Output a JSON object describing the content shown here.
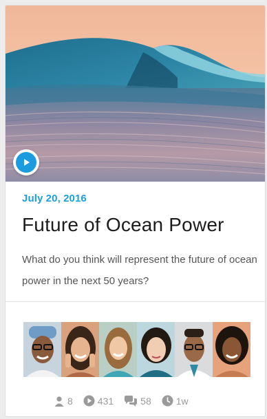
{
  "card": {
    "date": "July 20, 2016",
    "title": "Future of Ocean Power",
    "description": "What do you think will represent the future of ocean power in the next 50 years?"
  },
  "hero": {
    "image": "ocean-wave-photo",
    "play_icon": "play-icon"
  },
  "participants": [
    {
      "icon": "avatar-1"
    },
    {
      "icon": "avatar-2"
    },
    {
      "icon": "avatar-3"
    },
    {
      "icon": "avatar-4"
    },
    {
      "icon": "avatar-5"
    },
    {
      "icon": "avatar-6"
    }
  ],
  "stats": {
    "members": {
      "icon": "user-icon",
      "value": "8"
    },
    "plays": {
      "icon": "play-circle-icon",
      "value": "431"
    },
    "comments": {
      "icon": "comments-icon",
      "value": "58"
    },
    "age": {
      "icon": "clock-icon",
      "value": "1w"
    }
  },
  "colors": {
    "accent": "#1aa0dc",
    "play_button": "#1b9be0"
  }
}
